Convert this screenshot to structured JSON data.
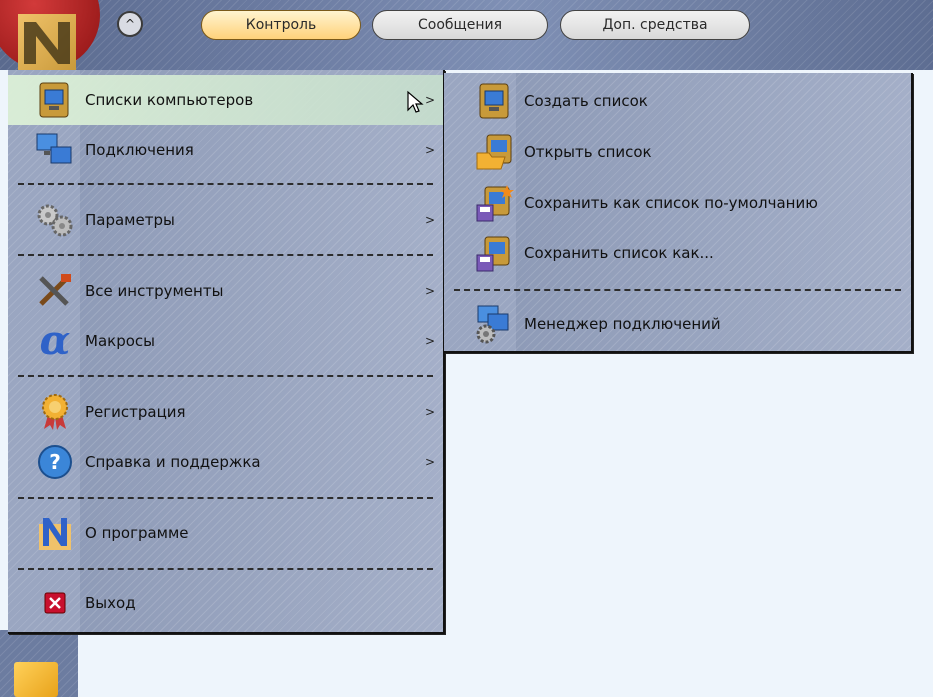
{
  "colors": {
    "hover_item": "#dcf0d7",
    "menu_bg": "#9aa6c1",
    "active_tab": "#ffd27a",
    "exit_red": "#c8102e"
  },
  "toolbar": {
    "collapse_label": "^",
    "tabs": [
      {
        "label": "Контроль",
        "active": true
      },
      {
        "label": "Сообщения",
        "active": false
      },
      {
        "label": "Доп. средства",
        "active": false
      }
    ]
  },
  "main_menu": {
    "items": [
      {
        "label": "Списки компьютеров",
        "icon": "computer-list-icon",
        "has_submenu": true,
        "highlighted": true
      },
      {
        "label": "Подключения",
        "icon": "connections-icon",
        "has_submenu": true
      },
      {
        "label": "Параметры",
        "icon": "gears-icon",
        "has_submenu": true
      },
      {
        "label": "Все инструменты",
        "icon": "tools-icon",
        "has_submenu": true
      },
      {
        "label": "Макросы",
        "icon": "alpha-macro-icon",
        "has_submenu": true
      },
      {
        "label": "Регистрация",
        "icon": "registration-badge-icon",
        "has_submenu": true
      },
      {
        "label": "Справка и поддержка",
        "icon": "help-icon",
        "has_submenu": true
      },
      {
        "label": "О программе",
        "icon": "about-logo-icon",
        "has_submenu": false
      },
      {
        "label": "Выход",
        "icon": "exit-icon",
        "has_submenu": false
      }
    ],
    "arrow_glyph": ">"
  },
  "submenu": {
    "items": [
      {
        "label": "Создать список",
        "icon": "new-list-icon"
      },
      {
        "label": "Открыть список",
        "icon": "open-list-icon"
      },
      {
        "label": "Сохранить как список по-умолчанию",
        "icon": "save-default-icon"
      },
      {
        "label": "Сохранить список как...",
        "icon": "save-as-icon"
      },
      {
        "label": "Менеджер подключений",
        "icon": "connection-manager-icon"
      }
    ]
  }
}
